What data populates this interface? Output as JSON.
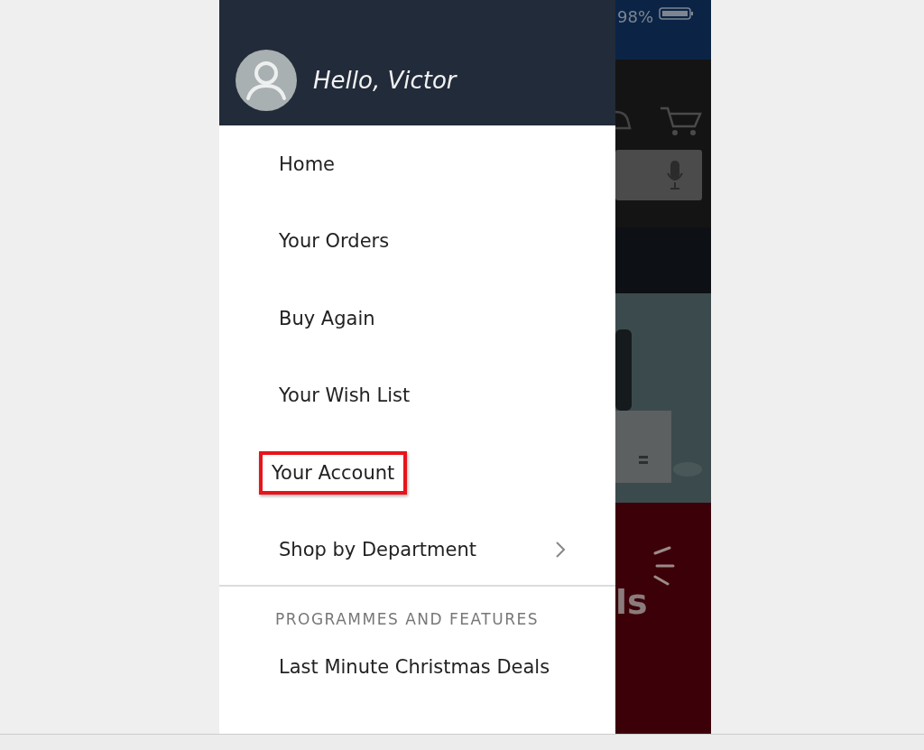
{
  "status_bar": {
    "battery_text": "98%"
  },
  "drawer": {
    "greeting": "Hello, Victor",
    "items": [
      {
        "label": "Home",
        "highlighted": false,
        "has_arrow": false
      },
      {
        "label": "Your Orders",
        "highlighted": false,
        "has_arrow": false
      },
      {
        "label": "Buy Again",
        "highlighted": false,
        "has_arrow": false
      },
      {
        "label": "Your Wish List",
        "highlighted": false,
        "has_arrow": false
      },
      {
        "label": "Your Account",
        "highlighted": true,
        "has_arrow": false
      },
      {
        "label": "Shop by Department",
        "highlighted": false,
        "has_arrow": true
      }
    ],
    "section_title": "PROGRAMMES AND FEATURES",
    "section_items": [
      {
        "label": "Last Minute Christmas Deals"
      }
    ]
  },
  "background_page": {
    "banner_text": "ls"
  }
}
